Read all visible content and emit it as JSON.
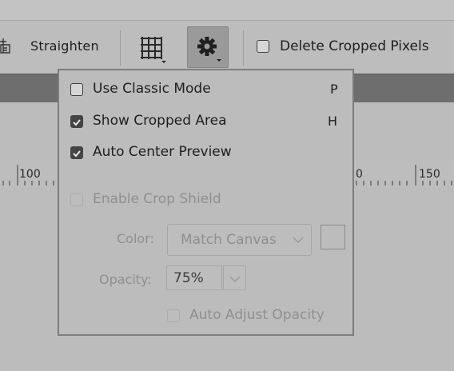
{
  "toolbar": {
    "straighten_label": "Straighten",
    "overlay_icon": "grid-overlay-icon",
    "settings_icon": "gear-icon",
    "delete_cropped": {
      "label": "Delete Cropped Pixels",
      "checked": false
    }
  },
  "ruler": {
    "labels": [
      "100",
      "0",
      "150"
    ]
  },
  "popup": {
    "items": [
      {
        "label": "Use Classic Mode",
        "checked": false,
        "shortcut": "P"
      },
      {
        "label": "Show Cropped Area",
        "checked": true,
        "shortcut": "H"
      },
      {
        "label": "Auto Center Preview",
        "checked": true,
        "shortcut": ""
      }
    ],
    "crop_shield": {
      "label": "Enable Crop Shield",
      "checked": false,
      "enabled": false
    },
    "color": {
      "label": "Color:",
      "value": "Match Canvas"
    },
    "opacity": {
      "label": "Opacity:",
      "value": "75%"
    },
    "auto_adjust": {
      "label": "Auto Adjust Opacity",
      "checked": false
    }
  },
  "colors": {
    "panel_bg": "#bcbcbc",
    "dark_band": "#6e6e6e",
    "active_button": "#9a9a9a",
    "disabled_text": "#8f8f8f"
  }
}
